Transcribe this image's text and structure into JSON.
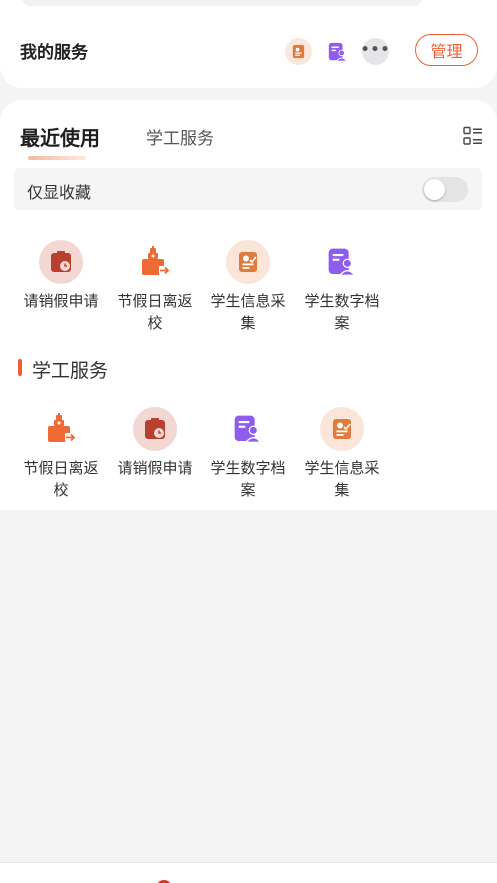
{
  "my_services": {
    "title": "我的服务",
    "manage_label": "管理",
    "shortcut_icons": [
      "student-info-icon",
      "student-archive-icon",
      "more-icon"
    ]
  },
  "tabs": [
    {
      "label": "最近使用",
      "active": true
    },
    {
      "label": "学工服务",
      "active": false
    }
  ],
  "favorites_only": {
    "label": "仅显收藏",
    "enabled": false
  },
  "recent_apps": [
    {
      "label": "请销假申请",
      "icon": "leave-request-icon"
    },
    {
      "label": "节假日离返校",
      "icon": "holiday-return-icon"
    },
    {
      "label": "学生信息采集",
      "icon": "student-info-icon"
    },
    {
      "label": "学生数字档案",
      "icon": "student-archive-icon"
    }
  ],
  "section": {
    "title": "学工服务"
  },
  "service_apps": [
    {
      "label": "节假日离返校",
      "icon": "holiday-return-icon"
    },
    {
      "label": "请销假申请",
      "icon": "leave-request-icon"
    },
    {
      "label": "学生数字档案",
      "icon": "student-archive-icon"
    },
    {
      "label": "学生信息采集",
      "icon": "student-info-icon"
    }
  ],
  "colors": {
    "accent": "#ec5f34",
    "leave_red": "#b8402f",
    "holiday_orange": "#f06a34",
    "info_orange": "#e07b3c",
    "archive_purple": "#8f5cf0"
  }
}
